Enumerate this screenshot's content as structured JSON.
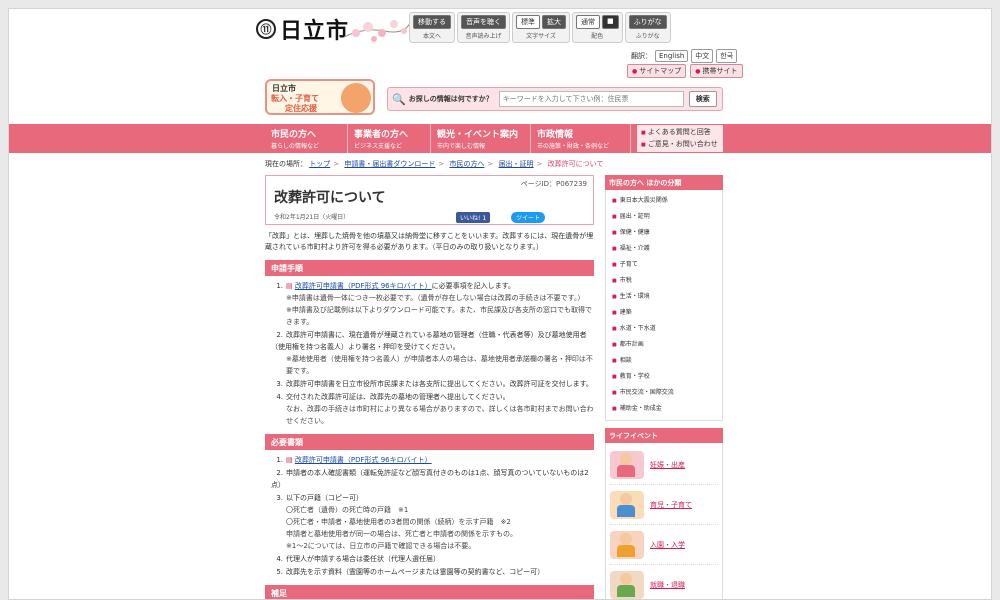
{
  "header": {
    "logo_mark": "⑪",
    "city_name": "日立市",
    "tools": [
      {
        "buttons": [
          "移動する"
        ],
        "caption": "本文へ"
      },
      {
        "buttons": [
          "音声を聴く"
        ],
        "caption": "音声読み上げ"
      },
      {
        "buttons": [
          "標準",
          "拡大"
        ],
        "caption": "文字サイズ"
      },
      {
        "buttons": [
          "通常",
          "■"
        ],
        "caption": "配色"
      },
      {
        "buttons": [
          "ふりがな"
        ],
        "caption": "ふりがな"
      }
    ],
    "lang_label": "翻訳：",
    "languages": [
      "English",
      "中文",
      "한국"
    ],
    "site_links": [
      "サイトマップ",
      "携帯サイト"
    ],
    "promo": {
      "line1": "日立市",
      "line2": "転入・子育て",
      "line3": "定住応援"
    },
    "search": {
      "label": "お探しの情報は何ですか？",
      "placeholder": "キーワードを入力して下さい例：住民票",
      "button": "検索"
    }
  },
  "nav": [
    {
      "title": "市民の方へ",
      "sub": "暮らしの情報など"
    },
    {
      "title": "事業者の方へ",
      "sub": "ビジネス支援など"
    },
    {
      "title": "観光・イベント案内",
      "sub": "市内で楽しむ情報"
    },
    {
      "title": "市政情報",
      "sub": "市の施策・財政・条例など"
    }
  ],
  "nav_side": [
    "よくある質問と回答",
    "ご意見・お問い合わせ"
  ],
  "breadcrumb": {
    "label": "現在の場所：",
    "items": [
      "トップ",
      "申請書・届出書ダウンロード",
      "市民の方へ",
      "届出・証明"
    ],
    "current": "改葬許可について"
  },
  "page": {
    "page_id": "ページID：P067239",
    "title": "改葬許可について",
    "date": "令和2年1月21日（火曜日）",
    "fb": "いいね! 1",
    "tw": "ツイート",
    "intro": "「改葬」とは、埋葬した焼骨を他の墳墓又は納骨堂に移すことをいいます。改葬するには、現在遺骨が埋蔵されている市町村より許可を得る必要があります。（平日のみの取り扱いとなります。）"
  },
  "section1": {
    "heading": "申請手順",
    "items": [
      {
        "num": "1.",
        "link": "改葬許可申請書（PDF形式 96キロバイト）",
        "text": "に必要事項を記入します。",
        "subs": [
          "※申請書は遺骨一体につき一枚必要です。（遺骨が存在しない場合は改葬の手続きは不要です。）",
          "※申請書及び記載例は以下よりダウンロード可能です。また、市民課及び各支所の窓口でも取得できます。"
        ]
      },
      {
        "num": "2.",
        "link": "",
        "text": "改葬許可申請書に、現在遺骨が埋蔵されている墓地の管理者（住職・代表者等）及び墓地使用者（使用権を持つ名義人）より署名・押印を受けてください。",
        "subs": [
          "※墓地使用者（使用権を持つ名義人）が申請者本人の場合は、墓地使用者承諾欄の署名・押印は不要です。"
        ]
      },
      {
        "num": "3.",
        "link": "",
        "text": "改葬許可申請書を日立市役所市民課または各支所に提出してください。改葬許可証を交付します。",
        "subs": []
      },
      {
        "num": "4.",
        "link": "",
        "text": "交付された改葬許可証は、改葬先の墓地の管理者へ提出してください。",
        "subs": [
          "なお、改葬の手続きは市町村により異なる場合がありますので、詳しくは各市町村までお問い合わせください。"
        ]
      }
    ]
  },
  "section2": {
    "heading": "必要書類",
    "items": [
      {
        "num": "1.",
        "link": "改葬許可申請書（PDF形式 96キロバイト）",
        "text": "",
        "subs": []
      },
      {
        "num": "2.",
        "link": "",
        "text": "申請者の本人確認書類（運転免許証など顔写真付きのものは1点、顔写真のついていないものは2点）",
        "subs": []
      },
      {
        "num": "3.",
        "link": "",
        "text": "以下の戸籍（コピー可）",
        "subs": [
          "〇死亡者（遺骨）の死亡時の戸籍　※1",
          "〇死亡者・申請者・墓地使用者の3者間の関係（続柄）を示す戸籍　※2",
          "申請者と墓地使用者が同一の場合は、死亡者と申請者の関係を示すもの。",
          "※1～2については、日立市の戸籍で確認できる場合は不要。"
        ]
      },
      {
        "num": "4.",
        "link": "",
        "text": "代理人が申請する場合は委任状（代理人選任届）",
        "subs": []
      },
      {
        "num": "5.",
        "link": "",
        "text": "改葬先を示す資料（霊園等のホームページまたは霊園等の契約書など、コピー可）",
        "subs": []
      }
    ]
  },
  "section3": {
    "heading": "補足"
  },
  "sidebar": {
    "heading": "市民の方へ ほかの分類",
    "items": [
      "東日本大震災関係",
      "届出・証明",
      "保健・健康",
      "福祉・介護",
      "子育て",
      "市税",
      "生活・環境",
      "建築",
      "水道・下水道",
      "都市計画",
      "相談",
      "教育・学校",
      "市民交流・国際交流",
      "補助金・助成金"
    ]
  },
  "life": {
    "heading": "ライフイベント",
    "items": [
      {
        "label": "妊娠・出産",
        "color": "#f7c8d0"
      },
      {
        "label": "育児・子育て",
        "color": "#f9dcb8"
      },
      {
        "label": "入園・入学",
        "color": "#f7d3c0"
      },
      {
        "label": "就職・退職",
        "color": "#f2d9c4"
      }
    ]
  }
}
